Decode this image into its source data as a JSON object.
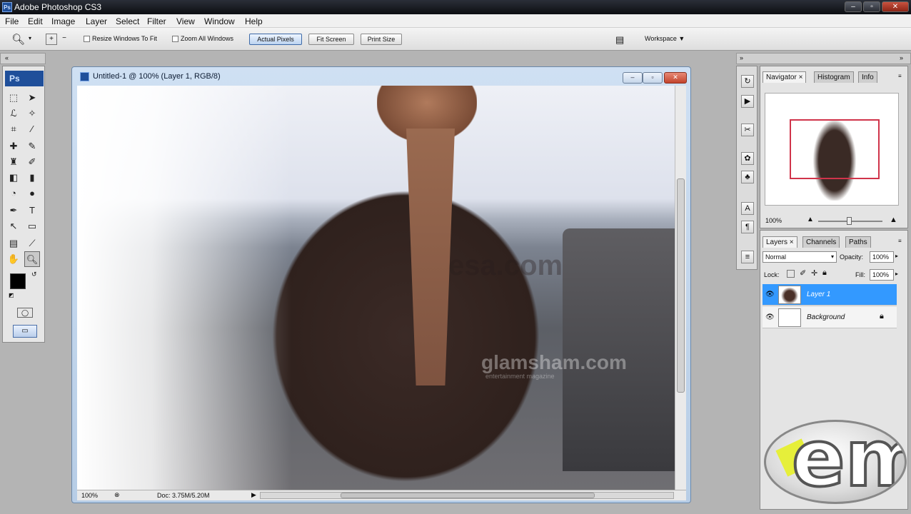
{
  "window": {
    "title": "Adobe Photoshop CS3",
    "app_badge": "Ps"
  },
  "menu": [
    "File",
    "Edit",
    "Image",
    "Layer",
    "Select",
    "Filter",
    "View",
    "Window",
    "Help"
  ],
  "options": {
    "resize_windows_label": "Resize Windows To Fit",
    "zoom_all_label": "Zoom All Windows",
    "actual_pixels": "Actual Pixels",
    "fit_screen": "Fit Screen",
    "print_size": "Print Size",
    "workspace": "Workspace ▼"
  },
  "toolbox": {
    "badge": "Ps"
  },
  "document": {
    "title": "Untitled-1 @ 100% (Layer 1, RGB/8)",
    "zoom": "100%",
    "doc_size": "Doc: 3.75M/5.20M",
    "watermark_1": "esa.com",
    "watermark_2": "glamsham.com",
    "watermark_3": "entertainment magazine"
  },
  "navigator": {
    "tabs": [
      "Navigator ×",
      "Histogram",
      "Info"
    ],
    "zoom": "100%"
  },
  "layers": {
    "tabs": [
      "Layers ×",
      "Channels",
      "Paths"
    ],
    "blend_mode": "Normal",
    "opacity_label": "Opacity:",
    "opacity_value": "100%",
    "lock_label": "Lock:",
    "fill_label": "Fill:",
    "fill_value": "100%",
    "items": [
      {
        "name": "Layer 1",
        "selected": true
      },
      {
        "name": "Background",
        "selected": false,
        "locked": true
      }
    ]
  },
  "colors": {
    "selection": "#3399ff",
    "titlebar": "#0c0e12",
    "accent": "#1f4f9a"
  },
  "logo": "em"
}
